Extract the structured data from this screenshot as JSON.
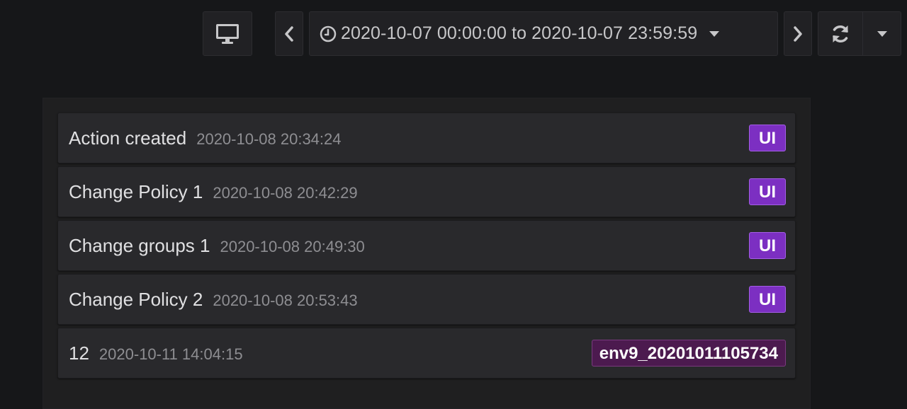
{
  "toolbar": {
    "tv_mode_icon": "monitor-icon",
    "prev_icon": "chevron-left-icon",
    "next_icon": "chevron-right-icon",
    "time_range": "2020-10-07 00:00:00 to 2020-10-07 23:59:59",
    "clock_icon": "clock-icon",
    "range_caret_icon": "caret-down-icon",
    "refresh_icon": "refresh-icon",
    "refresh_interval_caret_icon": "caret-down-icon"
  },
  "annotations": [
    {
      "title": "Action created",
      "time": "2020-10-08 20:34:24",
      "tag": "UI",
      "tag_color": "#7c2fc2"
    },
    {
      "title": "Change Policy 1",
      "time": "2020-10-08 20:42:29",
      "tag": "UI",
      "tag_color": "#7c2fc2"
    },
    {
      "title": "Change groups 1",
      "time": "2020-10-08 20:49:30",
      "tag": "UI",
      "tag_color": "#7c2fc2"
    },
    {
      "title": "Change Policy 2",
      "time": "2020-10-08 20:53:43",
      "tag": "UI",
      "tag_color": "#7c2fc2"
    },
    {
      "title": "12",
      "time": "2020-10-11 14:04:15",
      "tag": "env9_20201011105734",
      "tag_color": "#4c1a4f"
    }
  ],
  "colors": {
    "background": "#161719",
    "panel": "#1f1f20",
    "row": "#29292c",
    "tag_ui": "#7c2fc2",
    "tag_env": "#4c1a4f"
  }
}
